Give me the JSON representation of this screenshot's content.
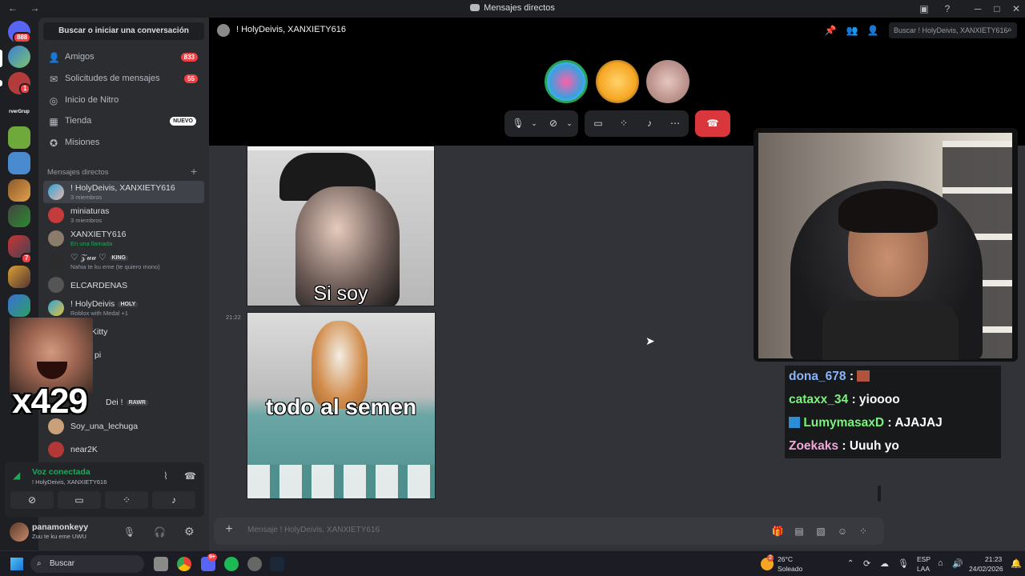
{
  "window": {
    "title": "Mensajes directos"
  },
  "rail": {
    "badge_main": "888",
    "badge_2": "1",
    "badge_3": "7",
    "server_label": "rverGrup"
  },
  "sidebar": {
    "search_label": "Buscar o iniciar una conversación",
    "nav": [
      {
        "label": "Amigos",
        "badge": "833"
      },
      {
        "label": "Solicitudes de mensajes",
        "badge": "55"
      },
      {
        "label": "Inicio de Nitro"
      },
      {
        "label": "Tienda",
        "tag": "NUEVO"
      },
      {
        "label": "Misiones"
      }
    ],
    "dm_header": "Mensajes directos",
    "dms": [
      {
        "name": "! HolyDeivis, XANXIETY616",
        "sub": "3 miembros"
      },
      {
        "name": "miniaturas",
        "sub": "3 miembros"
      },
      {
        "name": "XANXIETY616",
        "sub": "En una llamada"
      },
      {
        "name": "♡ 𝒵𝓊𝓊 ♡",
        "tag": "KING",
        "sub": "Nahia te ku eme (te quiero mono)"
      },
      {
        "name": "ELCARDENAS"
      },
      {
        "name": "! HolyDeivis",
        "tag": "HOLY",
        "sub": "Roblox with Medal +1"
      },
      {
        "name": "Kitty"
      },
      {
        "name": "pi"
      },
      {
        "name": "Dei !",
        "tag": "RAWR"
      },
      {
        "name": "Soy_una_lechuga"
      },
      {
        "name": "near2K"
      }
    ],
    "meme_text": "x429"
  },
  "voice": {
    "status": "Voz conectada",
    "channel": "! HolyDeivis, XANXIETY616"
  },
  "user": {
    "name": "panamonkeyy",
    "status": "Zuu te ku eme UWU"
  },
  "chat": {
    "title": "! HolyDeivis, XANXIETY616",
    "search_placeholder": "Buscar ! HolyDeivis, XANXIETY616",
    "timestamp": "21:22",
    "image1_caption": "Si soy",
    "image2_caption": "todo al semen",
    "composer_placeholder": "Mensaje ! HolyDeivis, XANXIETY616"
  },
  "overlay": {
    "lines": [
      {
        "user": "dona_678",
        "text": ":",
        "color": "#8ab4f8"
      },
      {
        "user": "cataxx_34",
        "text": ": yioooo",
        "color": "#7cf27c"
      },
      {
        "user": "LumymasaxD",
        "text": ": AJAJAJ",
        "color": "#7cf27c"
      },
      {
        "user": "Zoekaks",
        "text": ": Uuuh yo",
        "color": "#f2a7d8"
      }
    ]
  },
  "taskbar": {
    "search_label": "Buscar",
    "weather_temp": "26°C",
    "weather_desc": "Soleado",
    "weather_badge": "2",
    "discord_badge": "9+",
    "lang": "ESP",
    "lang2": "LAA",
    "time": "21:23",
    "date": "24/02/2026"
  },
  "colors": {
    "accent": "#5865f2",
    "danger": "#da373c",
    "online": "#23a55a"
  }
}
